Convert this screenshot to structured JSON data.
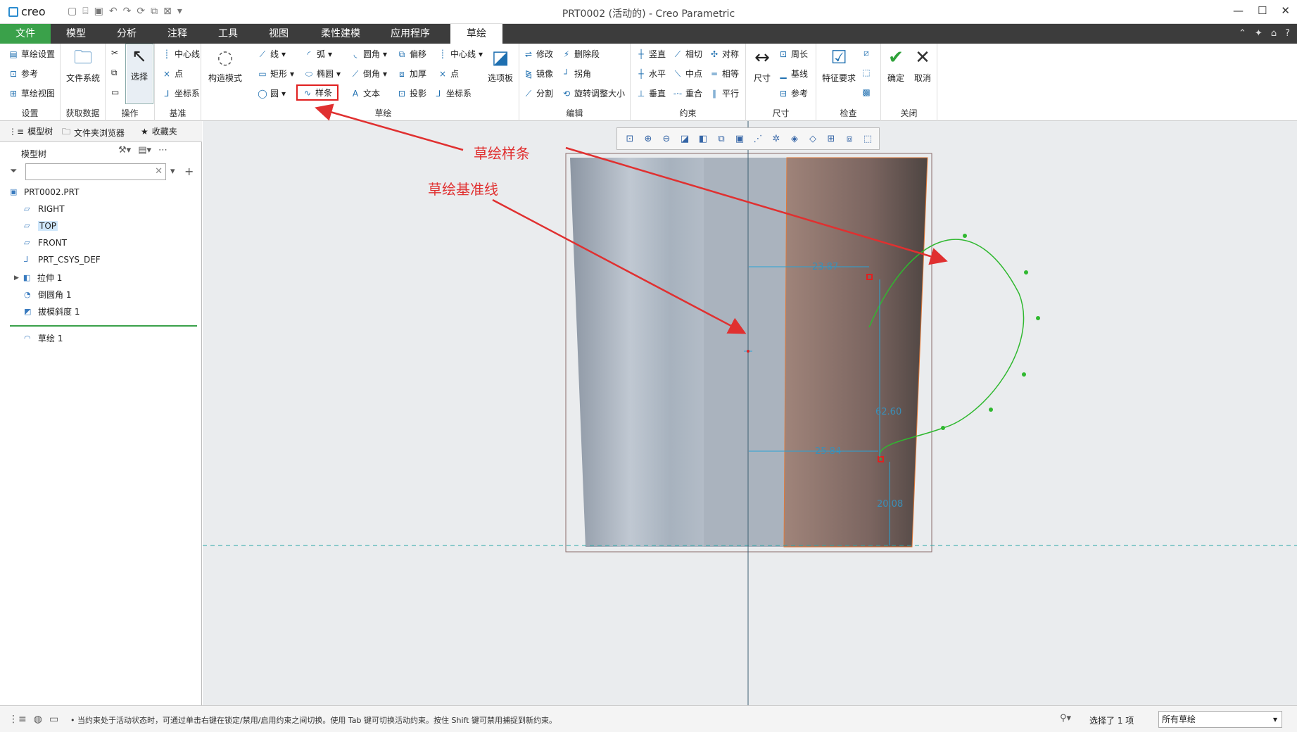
{
  "app": {
    "logo": "creo",
    "window_title": "PRT0002 (活动的) - Creo Parametric"
  },
  "tabs": [
    "文件",
    "模型",
    "分析",
    "注释",
    "工具",
    "视图",
    "柔性建模",
    "应用程序",
    "草绘"
  ],
  "ribbon": {
    "setup": {
      "items": [
        "草绘设置",
        "参考",
        "草绘视图"
      ],
      "label": "设置"
    },
    "getdata": {
      "big": "文件系统",
      "label": "获取数据"
    },
    "ops": {
      "big": "选择",
      "label": "操作"
    },
    "datum": {
      "items": [
        "中心线",
        "点",
        "坐标系"
      ],
      "label": "基准"
    },
    "construct": {
      "big": "构造模式"
    },
    "sketch": {
      "col1": [
        "线",
        "矩形",
        "圆"
      ],
      "col2": [
        "弧",
        "椭圆",
        "样条"
      ],
      "col3": [
        "圆角",
        "倒角",
        "文本"
      ],
      "col4": [
        "偏移",
        "加厚",
        "投影"
      ],
      "col5": [
        "中心线",
        "点",
        "坐标系"
      ],
      "big": "选项板",
      "label": "草绘"
    },
    "edit": {
      "items": [
        "修改",
        "删除段",
        "镜像",
        "拐角",
        "分割",
        "旋转调整大小"
      ],
      "label": "编辑"
    },
    "constrain": {
      "items": [
        "竖直",
        "相切",
        "对称",
        "水平",
        "中点",
        "相等",
        "垂直",
        "重合",
        "平行"
      ],
      "label": "约束"
    },
    "dimension": {
      "big": "尺寸",
      "items": [
        "周长",
        "基线",
        "参考"
      ],
      "label": "尺寸"
    },
    "inspect": {
      "big": "特征要求",
      "label": "检查"
    },
    "close": {
      "ok": "确定",
      "cancel": "取消",
      "label": "关闭"
    }
  },
  "leftpanel": {
    "tabs": [
      "模型树",
      "文件夹浏览器",
      "收藏夹"
    ],
    "tree_header": "模型树",
    "tree": [
      "PRT0002.PRT",
      "RIGHT",
      "TOP",
      "FRONT",
      "PRT_CSYS_DEF",
      "拉伸 1",
      "倒圆角 1",
      "拔模斜度 1",
      "草绘 1"
    ]
  },
  "annotations": {
    "spline": "草绘样条",
    "centerline": "草绘基准线"
  },
  "dimensions": [
    "23.87",
    "62.60",
    "25.84",
    "20.08"
  ],
  "status": {
    "message": "当约束处于活动状态时，可通过单击右键在锁定/禁用/启用约束之间切换。使用 Tab 键可切换活动约束。按住 Shift 键可禁用捕捉到新约束。",
    "selection": "选择了 1 项",
    "filter": "所有草绘"
  },
  "colors": {
    "file_tab": "#3aa14a",
    "annotation": "#e03030",
    "spline": "#2fb82f",
    "dimension": "#29a3d6"
  }
}
